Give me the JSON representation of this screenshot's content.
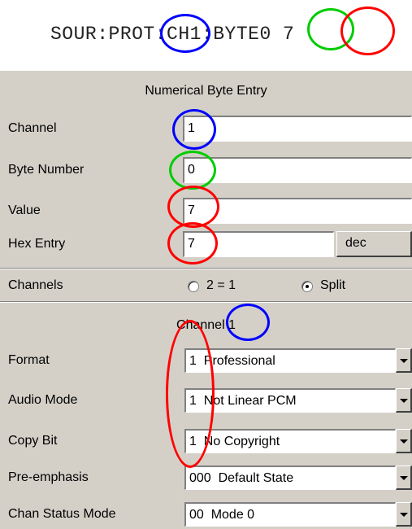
{
  "command": "SOUR:PROT:CH1:BYTE0 7",
  "numeric": {
    "title": "Numerical Byte Entry",
    "channel_label": "Channel",
    "channel_value": "1",
    "byte_label": "Byte Number",
    "byte_value": "0",
    "value_label": "Value",
    "value_value": "7",
    "hex_label": "Hex Entry",
    "hex_value": "7",
    "format_button": "dec"
  },
  "channels": {
    "label": "Channels",
    "option1": "2 = 1",
    "option2": "Split",
    "selected": "Split"
  },
  "channel1": {
    "title": "Channel 1",
    "format_label": "Format",
    "format_value": "1  Professional",
    "audio_label": "Audio Mode",
    "audio_value": "1  Not Linear PCM",
    "copy_label": "Copy Bit",
    "copy_value": "1  No Copyright",
    "pre_label": "Pre-emphasis",
    "pre_value": "000  Default State",
    "chan_label": "Chan Status Mode",
    "chan_value": "00  Mode 0"
  },
  "annotation_colors": {
    "channel": "#0000ff",
    "byte": "#00cc00",
    "value": "#ff0000"
  }
}
